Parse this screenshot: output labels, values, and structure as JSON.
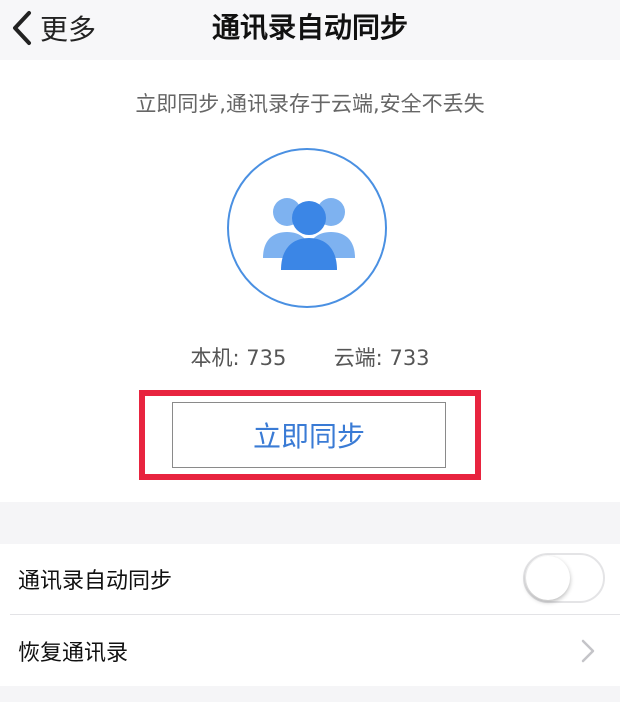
{
  "nav": {
    "back_label": "更多",
    "title": "通讯录自动同步"
  },
  "sync_panel": {
    "tagline": "立即同步,通讯录存于云端,安全不丢失",
    "local_label": "本机:",
    "local_count": "735",
    "cloud_label": "云端:",
    "cloud_count": "733",
    "sync_button_label": "立即同步"
  },
  "settings": {
    "auto_sync_label": "通讯录自动同步",
    "auto_sync_enabled": false,
    "restore_label": "恢复通讯录"
  },
  "colors": {
    "accent": "#3a7bd5",
    "highlight": "#e8243f",
    "icon_blue": "#3b86e6",
    "icon_blue_light": "#7eb2f0"
  }
}
